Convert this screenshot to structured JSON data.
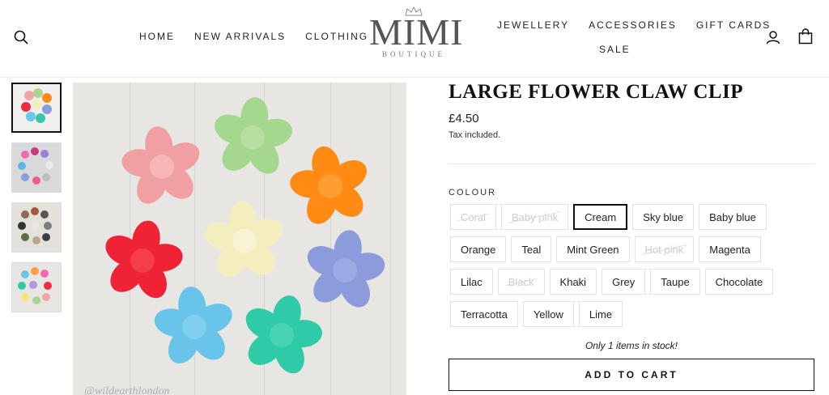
{
  "header": {
    "nav_left": [
      "HOME",
      "NEW ARRIVALS",
      "CLOTHING"
    ],
    "nav_right_top": [
      "JEWELLERY",
      "ACCESSORIES",
      "GIFT CARDS"
    ],
    "nav_right_bottom": "SALE",
    "logo": {
      "main": "MIMI",
      "sub": "BOUTIQUE"
    },
    "icons": [
      "search-icon",
      "account-icon",
      "cart-icon"
    ]
  },
  "gallery": {
    "watermark": "@wildearthlondon",
    "thumbnails": 4
  },
  "product": {
    "title": "LARGE FLOWER CLAW CLIP",
    "price": "£4.50",
    "tax_note": "Tax included.",
    "colour_label": "COLOUR",
    "colours": [
      {
        "name": "Coral",
        "available": false
      },
      {
        "name": "Baby pink",
        "available": false
      },
      {
        "name": "Cream",
        "available": true,
        "selected": true
      },
      {
        "name": "Sky blue",
        "available": true
      },
      {
        "name": "Baby blue",
        "available": true
      },
      {
        "name": "Orange",
        "available": true
      },
      {
        "name": "Teal",
        "available": true
      },
      {
        "name": "Mint Green",
        "available": true
      },
      {
        "name": "Hot pink",
        "available": false
      },
      {
        "name": "Magenta",
        "available": true
      },
      {
        "name": "Lilac",
        "available": true
      },
      {
        "name": "Black",
        "available": false
      },
      {
        "name": "Khaki",
        "available": true
      },
      {
        "name": "Grey",
        "available": true
      },
      {
        "name": "Taupe",
        "available": true
      },
      {
        "name": "Chocolate",
        "available": true
      },
      {
        "name": "Terracotta",
        "available": true
      },
      {
        "name": "Yellow",
        "available": true
      },
      {
        "name": "Lime",
        "available": true
      }
    ],
    "stock_note": "Only 1 items in stock!",
    "add_to_cart": "ADD TO CART"
  }
}
